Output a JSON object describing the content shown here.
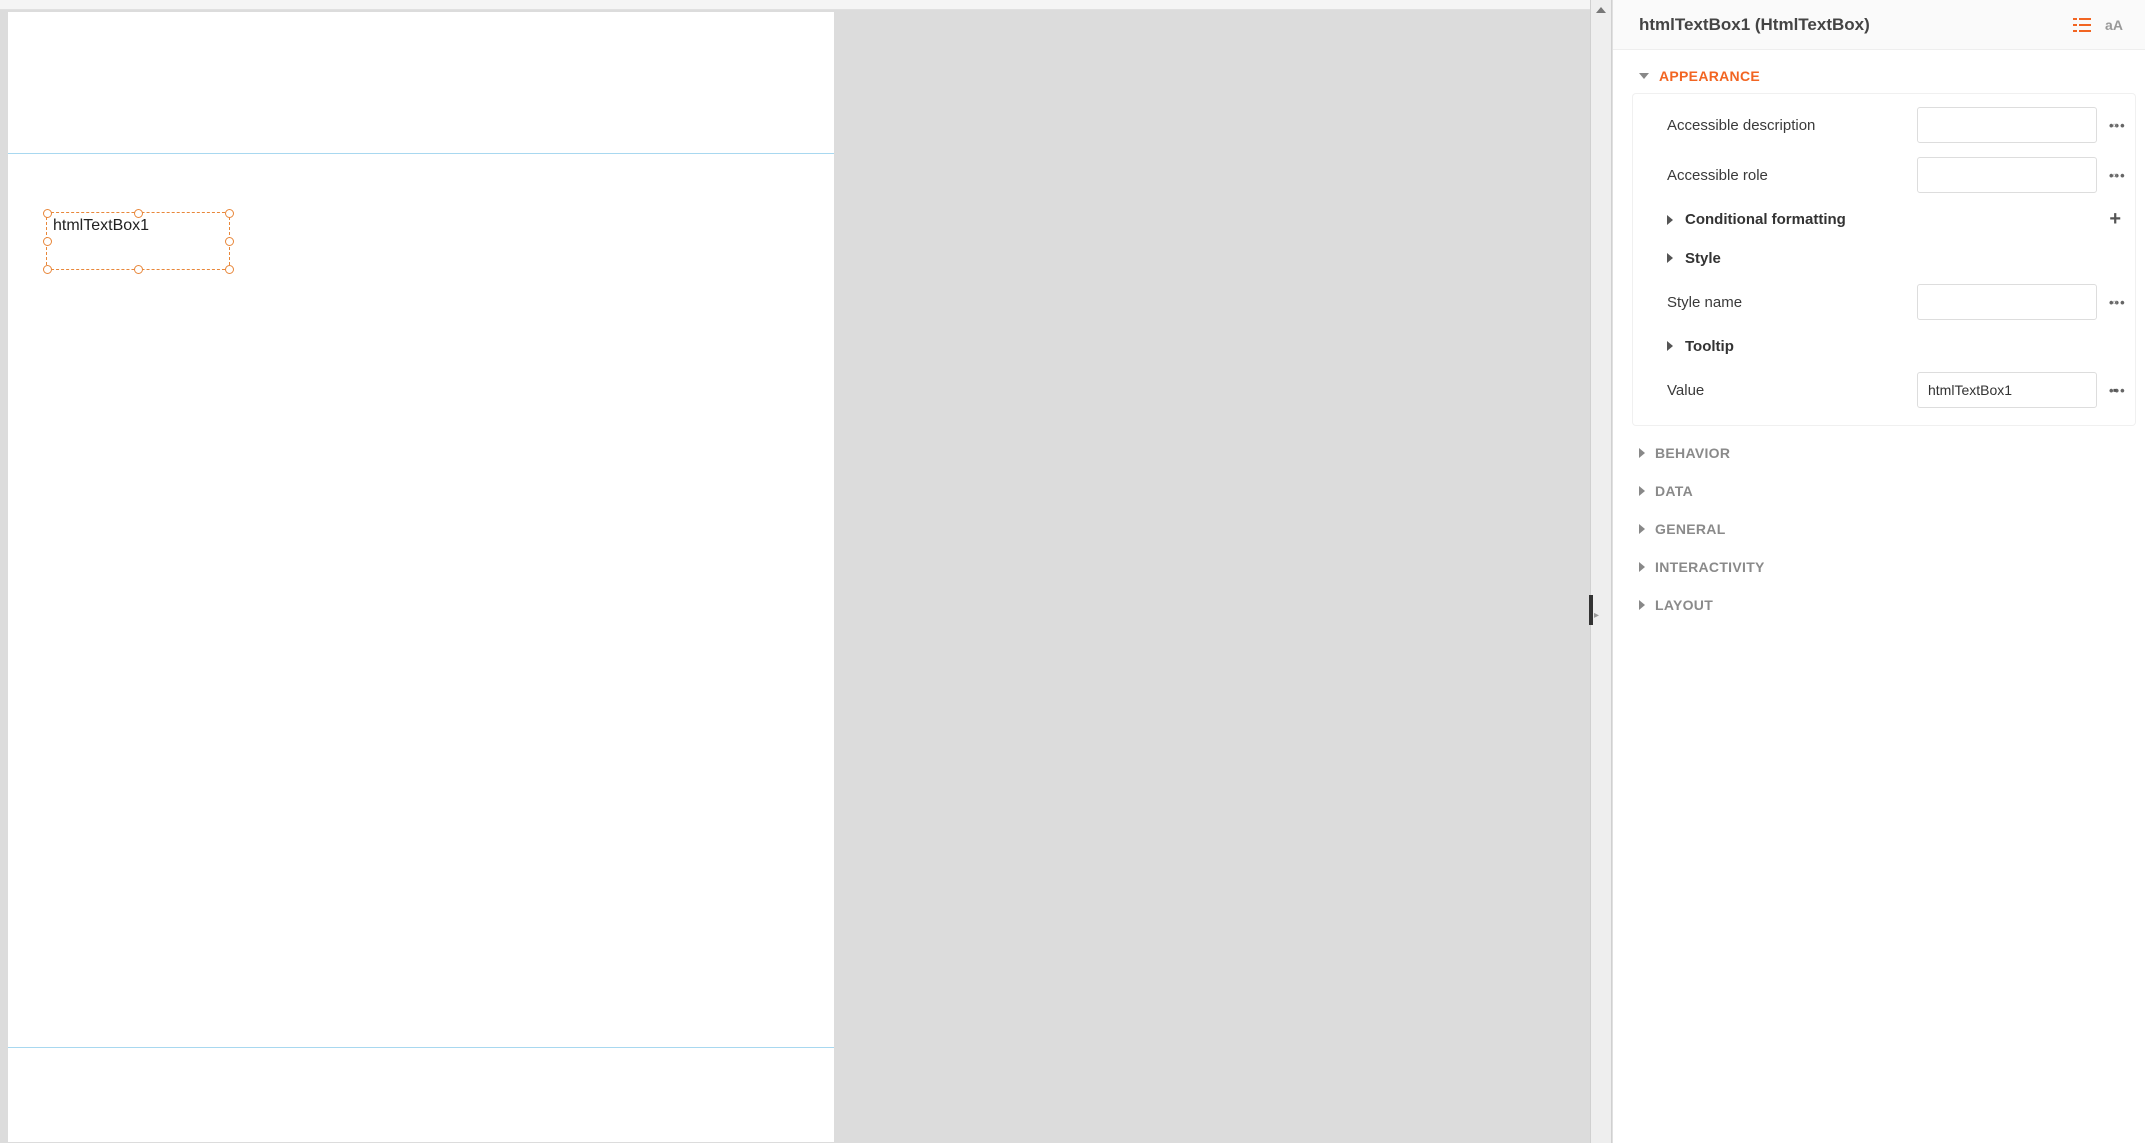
{
  "canvas": {
    "selected_element_label": "htmlTextBox1"
  },
  "panel": {
    "title": "htmlTextBox1 (HtmlTextBox)",
    "sections": {
      "appearance": {
        "label": "APPEARANCE",
        "props": {
          "accessible_description": {
            "label": "Accessible description",
            "value": ""
          },
          "accessible_role": {
            "label": "Accessible role",
            "value": ""
          },
          "conditional_formatting": {
            "label": "Conditional formatting"
          },
          "style": {
            "label": "Style"
          },
          "style_name": {
            "label": "Style name",
            "value": ""
          },
          "tooltip": {
            "label": "Tooltip"
          },
          "value": {
            "label": "Value",
            "value": "htmlTextBox1"
          }
        }
      },
      "behavior": {
        "label": "BEHAVIOR"
      },
      "data": {
        "label": "DATA"
      },
      "general": {
        "label": "GENERAL"
      },
      "interactivity": {
        "label": "INTERACTIVITY"
      },
      "layout": {
        "label": "LAYOUT"
      }
    }
  }
}
